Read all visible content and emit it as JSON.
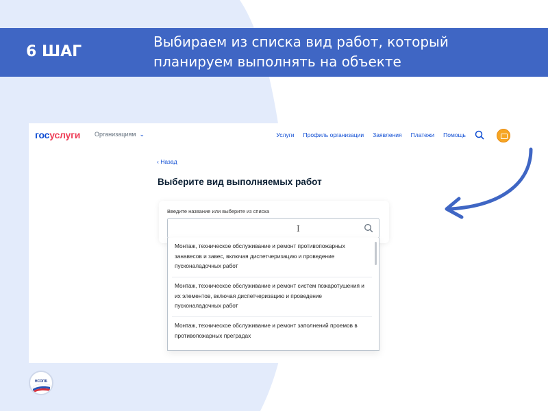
{
  "slide": {
    "step": "6 ШАГ",
    "instruction": "Выбираем из списка вид работ, который\nпланируем выполнять на объекте"
  },
  "gosuslugi": {
    "logo_part1": "гос",
    "logo_part2": "услуги",
    "org_menu": "Организациям",
    "nav": [
      "Услуги",
      "Профиль организации",
      "Заявления",
      "Платежи",
      "Помощь"
    ],
    "back": "Назад",
    "page_title": "Выберите вид выполняемых работ",
    "field_label": "Введите название или выберите из списка",
    "input_value": "",
    "options": [
      "Монтаж, техническое обслуживание и ремонт противопожарных занавесов и завес, включая диспетчеризацию и проведение пусконаладочных работ",
      "Монтаж, техническое обслуживание и ремонт систем пожаротушения и их элементов, включая диспетчеризацию и проведение пусконаладочных работ",
      "Монтаж, техническое обслуживание и ремонт заполнений проемов в противопожарных преградах"
    ]
  },
  "footer": {
    "logo_text": "НСОПБ"
  },
  "colors": {
    "banner": "#3f66c4",
    "background_shape": "#e3ebfb",
    "arrow": "#3f66c4",
    "link": "#0d4cd3"
  }
}
